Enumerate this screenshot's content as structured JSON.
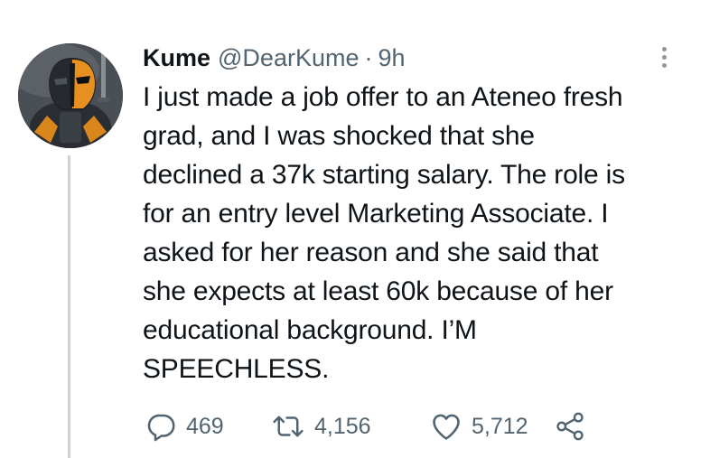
{
  "tweet": {
    "author": {
      "name": "Kume",
      "handle": "@DearKume",
      "separator": "·",
      "time": "9h",
      "avatar_icon": "masked-mercenary-avatar"
    },
    "text_lines": [
      "I just made a job offer to an Ateneo fresh",
      "grad, and I was shocked that she",
      "declined a 37k starting salary. The role is",
      "for an entry level Marketing Associate. I",
      "asked for her reason and she said that",
      "she expects at least 60k because of her",
      "educational background. I’M",
      "SPEECHLESS."
    ],
    "actions": {
      "reply": {
        "icon": "reply-icon",
        "count": "469"
      },
      "retweet": {
        "icon": "retweet-icon",
        "count": "4,156"
      },
      "like": {
        "icon": "heart-icon",
        "count": "5,712"
      },
      "share": {
        "icon": "share-icon"
      }
    },
    "more_icon": "more-options-icon"
  },
  "colors": {
    "text": "#0f1419",
    "secondary": "#536471",
    "thread_line": "#c9d3dc",
    "avatar_orange": "#e8901f",
    "avatar_dark": "#1f2326"
  }
}
